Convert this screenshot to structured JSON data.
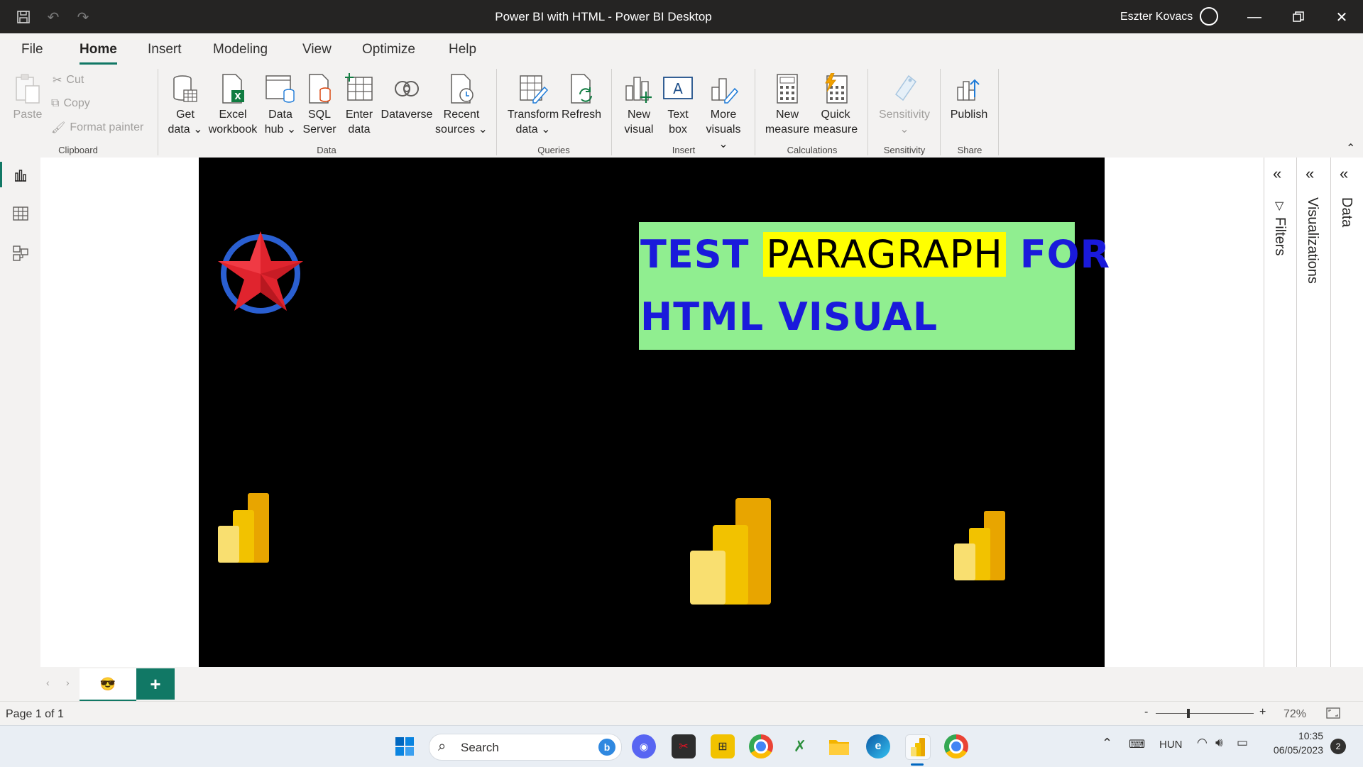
{
  "window": {
    "title": "Power BI with HTML - Power BI Desktop",
    "user": "Eszter Kovacs"
  },
  "menu": {
    "tabs": [
      "File",
      "Home",
      "Insert",
      "Modeling",
      "View",
      "Optimize",
      "Help"
    ],
    "active": "Home"
  },
  "ribbon": {
    "clipboard": {
      "paste": "Paste",
      "cut": "Cut",
      "copy": "Copy",
      "format_painter": "Format painter",
      "group": "Clipboard"
    },
    "data": {
      "get_data": [
        "Get",
        "data"
      ],
      "excel": [
        "Excel",
        "workbook"
      ],
      "data_hub": [
        "Data",
        "hub"
      ],
      "sql": [
        "SQL",
        "Server"
      ],
      "enter": [
        "Enter",
        "data"
      ],
      "dataverse": "Dataverse",
      "recent": [
        "Recent",
        "sources"
      ],
      "group": "Data"
    },
    "queries": {
      "transform": [
        "Transform",
        "data"
      ],
      "refresh": "Refresh",
      "group": "Queries"
    },
    "insert": {
      "new_visual": [
        "New",
        "visual"
      ],
      "text_box": [
        "Text",
        "box"
      ],
      "more_visuals": [
        "More",
        "visuals"
      ],
      "group": "Insert"
    },
    "calculations": {
      "new_measure": [
        "New",
        "measure"
      ],
      "quick_measure": [
        "Quick",
        "measure"
      ],
      "group": "Calculations"
    },
    "sensitivity": {
      "label": "Sensitivity",
      "group": "Sensitivity"
    },
    "share": {
      "publish": "Publish",
      "group": "Share"
    }
  },
  "report": {
    "text_line1_a": "TEST ",
    "text_line1_hl": "PARAGRAPH",
    "text_line1_b": " FOR",
    "text_line2": "HTML VISUAL"
  },
  "panes": {
    "filters": "Filters",
    "visualizations": "Visualizations",
    "data": "Data"
  },
  "pages": {
    "tab_emoji": "😎",
    "add": "+"
  },
  "status": {
    "page": "Page 1 of 1",
    "zoom": "72%",
    "zoom_minus": "-",
    "zoom_plus": "+"
  },
  "taskbar": {
    "search": "Search",
    "lang": "HUN",
    "time": "10:35",
    "date": "06/05/2023",
    "notif": "2"
  }
}
